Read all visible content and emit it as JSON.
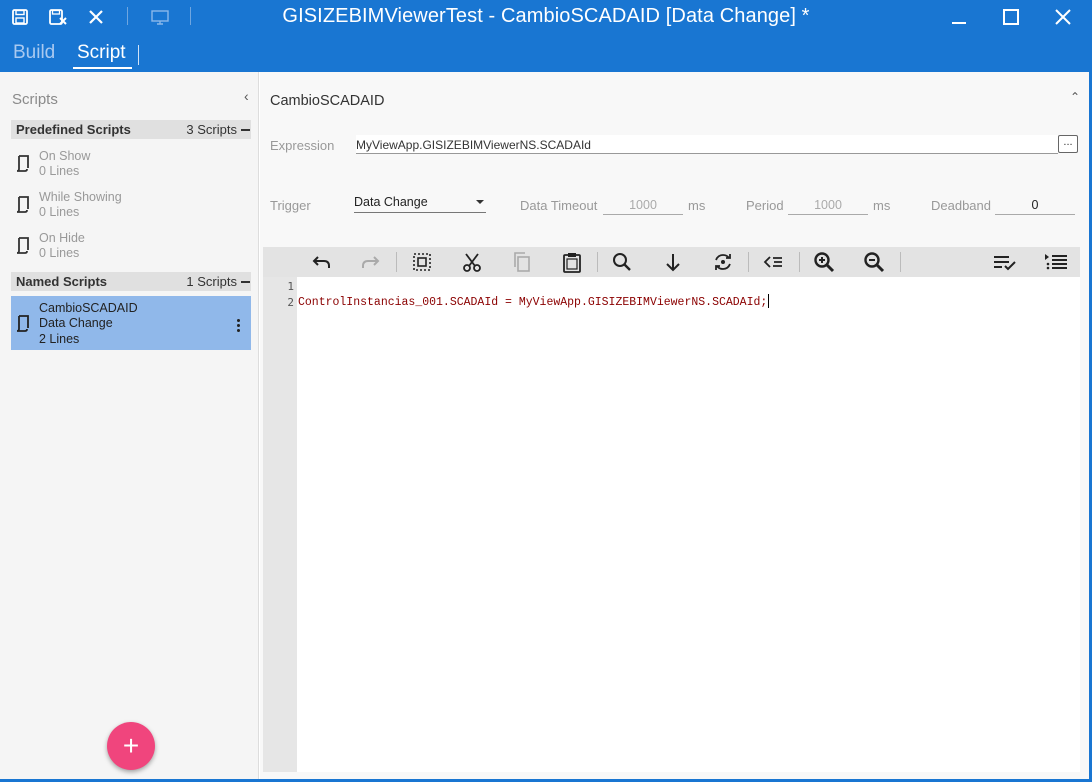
{
  "window": {
    "title": "GISIZEBIMViewerTest - CambioSCADAID [Data Change] *",
    "tabs": [
      {
        "label": "Build",
        "active": false
      },
      {
        "label": "Script",
        "active": true
      }
    ],
    "accent": "#1976d2"
  },
  "left_panel": {
    "title": "Scripts",
    "predefined": {
      "label": "Predefined Scripts",
      "count": "3 Scripts",
      "items": [
        {
          "name": "On Show",
          "lines": "0 Lines",
          "icon": "script-icon"
        },
        {
          "name": "While Showing",
          "lines": "0 Lines",
          "icon": "script-icon"
        },
        {
          "name": "On Hide",
          "lines": "0 Lines",
          "icon": "script-icon"
        }
      ]
    },
    "named": {
      "label": "Named Scripts",
      "count": "1 Scripts",
      "items": [
        {
          "name": "CambioSCADAID",
          "trigger": "Data Change",
          "lines": "2 Lines",
          "icon": "script-icon"
        }
      ]
    },
    "add_button": "+"
  },
  "script_panel": {
    "title": "CambioSCADAID",
    "expression": {
      "label": "Expression",
      "value": "MyViewApp.GISIZEBIMViewerNS.SCADAId",
      "browse_label": "..."
    },
    "trigger": {
      "label": "Trigger",
      "value": "Data Change"
    },
    "data_timeout": {
      "label": "Data Timeout",
      "value": "1000",
      "unit": "ms"
    },
    "period": {
      "label": "Period",
      "value": "1000",
      "unit": "ms"
    },
    "deadband": {
      "label": "Deadband",
      "value": "0"
    }
  },
  "toolbar": {
    "tools": [
      "undo-icon",
      "redo-icon",
      "select-all-icon",
      "cut-icon",
      "copy-icon",
      "paste-icon",
      "search-icon",
      "arrow-down-icon",
      "replace-icon",
      "outdent-icon",
      "zoom-in-icon",
      "zoom-out-icon",
      "check-list-icon",
      "list-icon"
    ]
  },
  "editor": {
    "line_numbers": [
      "1",
      "2"
    ],
    "lines": [
      "",
      "ControlInstancias_001.SCADAId = MyViewApp.GISIZEBIMViewerNS.SCADAId;"
    ]
  }
}
